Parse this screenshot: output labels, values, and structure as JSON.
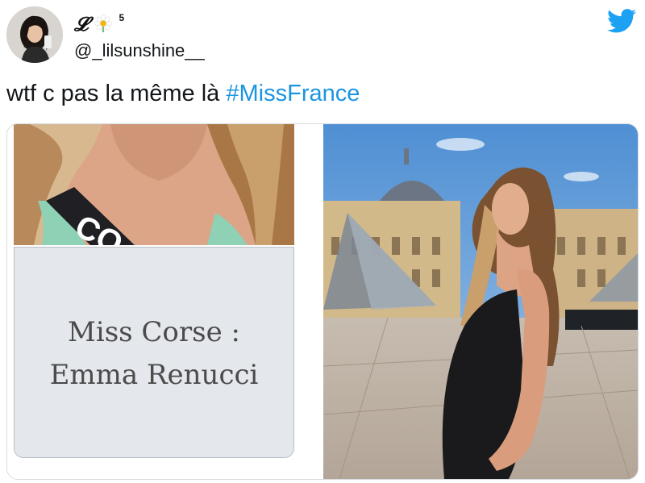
{
  "user": {
    "display_name_glyph": "𝓛",
    "display_name_emoji": "flower-emoji",
    "display_name_number": "5",
    "handle": "@_lilsunshine__",
    "avatar": "profile-photo"
  },
  "tweet": {
    "text": "wtf c pas la même là ",
    "hashtag": "#MissFrance"
  },
  "media": {
    "left_caption_line1": "Miss Corse :",
    "left_caption_line2": "Emma Renucci",
    "left_photo_desc": "sash-photo",
    "right_photo_desc": "louvre-portrait-photo"
  },
  "brand": {
    "icon": "twitter-bird-icon",
    "accent": "#1da1f2",
    "hashtag_color": "#1b95e0"
  }
}
